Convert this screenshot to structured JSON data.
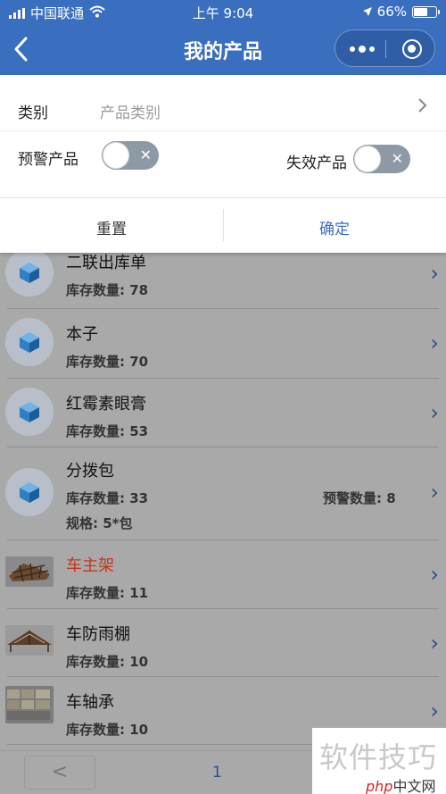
{
  "status_bar": {
    "carrier": "中国联通",
    "time": "上午 9:04",
    "battery": "66%",
    "battery_level": 0.66
  },
  "navbar": {
    "title": "我的产品",
    "back_icon": "chevron-left-icon",
    "menu_icon": "more-dots-icon",
    "close_icon": "target-circle-icon"
  },
  "filter": {
    "category_label": "类别",
    "category_value": "产品类别",
    "warning_label": "预警产品",
    "warning_on": false,
    "expired_label": "失效产品",
    "expired_on": false,
    "reset_label": "重置",
    "confirm_label": "确定"
  },
  "products": [
    {
      "name": "二联出库单",
      "stock": "库存数量: 78",
      "warn": "",
      "spec": "",
      "image": "cube-icon",
      "red": false
    },
    {
      "name": "本子",
      "stock": "库存数量: 70",
      "warn": "",
      "spec": "",
      "image": "cube-icon",
      "red": false
    },
    {
      "name": "红霉素眼膏",
      "stock": "库存数量: 53",
      "warn": "",
      "spec": "",
      "image": "cube-icon",
      "red": false
    },
    {
      "name": "分拨包",
      "stock": "库存数量: 33",
      "warn": "预警数量: 8",
      "spec": "规格: 5*包",
      "image": "cube-icon",
      "red": false
    },
    {
      "name": "车主架",
      "stock": "库存数量: 11",
      "warn": "",
      "spec": "",
      "image": "photo-thumbnail",
      "red": true
    },
    {
      "name": "车防雨棚",
      "stock": "库存数量: 10",
      "warn": "",
      "spec": "",
      "image": "photo-thumbnail",
      "red": false
    },
    {
      "name": "车轴承",
      "stock": "库存数量: 10",
      "warn": "",
      "spec": "",
      "image": "photo-thumbnail",
      "red": false
    }
  ],
  "pager": {
    "prev": "<",
    "page": "1"
  },
  "watermark": {
    "text": "软件技巧",
    "logo_php": "php",
    "logo_zh": "中文网"
  },
  "colors": {
    "brand_blue": "#3a6fbf",
    "overlay_gray": "#a9a9a9",
    "name_red": "#c4361c"
  }
}
